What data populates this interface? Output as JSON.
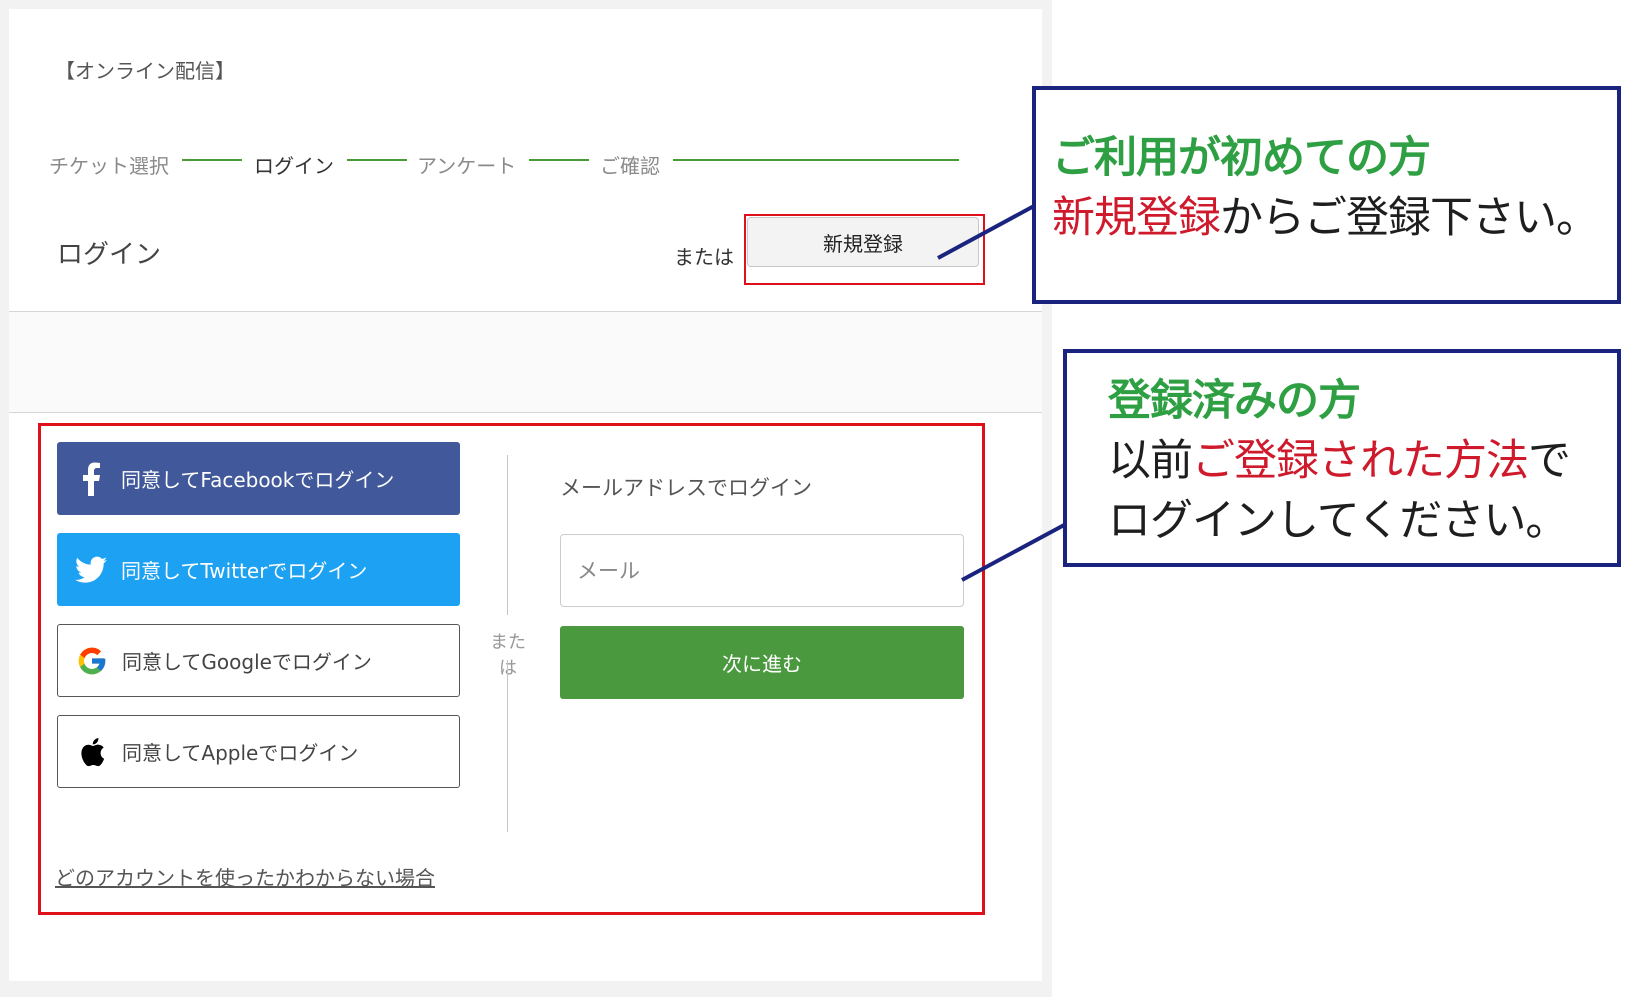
{
  "event_title": "【オンライン配信】",
  "steps": [
    "チケット選択",
    "ログイン",
    "アンケート",
    "ご確認"
  ],
  "header": {
    "login_heading": "ログイン",
    "or_label": "または",
    "register_button": "新規登録"
  },
  "social_logins": [
    {
      "label": "同意してFacebookでログイン",
      "icon": "facebook-icon"
    },
    {
      "label": "同意してTwitterでログイン",
      "icon": "twitter-icon"
    },
    {
      "label": "同意してGoogleでログイン",
      "icon": "google-icon"
    },
    {
      "label": "同意してAppleでログイン",
      "icon": "apple-icon"
    }
  ],
  "divider_or": "または",
  "email_login": {
    "heading": "メールアドレスでログイン",
    "placeholder": "メール",
    "next_button": "次に進む"
  },
  "forgot_link": "どのアカウントを使ったかわからない場合",
  "callouts": {
    "new_user": {
      "title": "ご利用が初めての方",
      "line2_highlight": "新規登録",
      "line2_rest": "からご登録下さい。"
    },
    "registered_user": {
      "title": "登録済みの方",
      "line2_a": "以前",
      "line2_highlight": "ご登録された方法",
      "line2_b": "で",
      "line3": "ログインしてください。"
    }
  },
  "colors": {
    "facebook": "#41589a",
    "twitter": "#1da1f2",
    "next_button": "#4a993e",
    "highlight_border": "#e0101b",
    "callout_border": "#1a237e",
    "callout_title": "#2ea043",
    "callout_emphasis": "#cf1a2c"
  }
}
